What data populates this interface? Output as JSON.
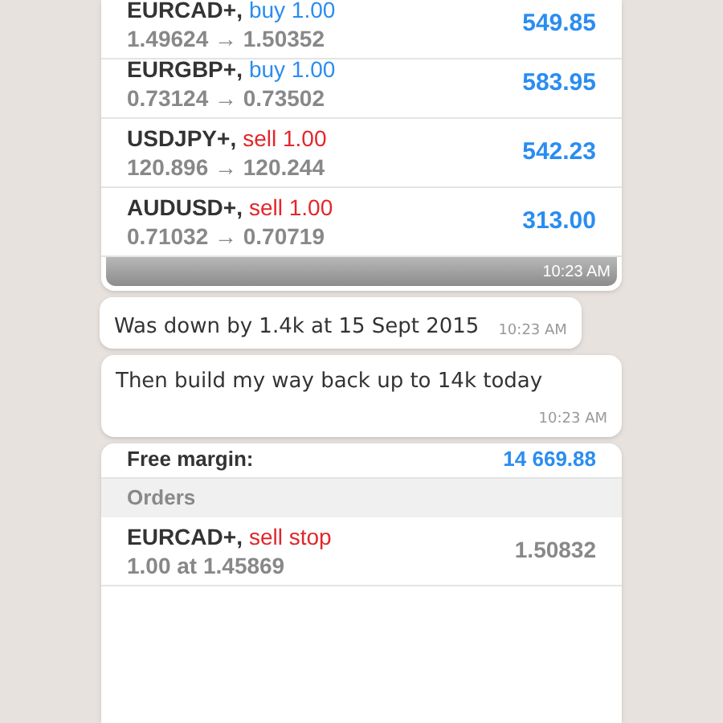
{
  "messages": [
    {
      "kind": "screenshot",
      "positions": [
        {
          "symbol": "EURCAD+,",
          "kind": "buy",
          "action": "buy 1.00",
          "prices": "1.49624 → 1.50352",
          "profit": "549.85"
        },
        {
          "symbol": "EURGBP+,",
          "kind": "buy",
          "action": "buy 1.00",
          "prices": "0.73124 → 0.73502",
          "profit": "583.95"
        },
        {
          "symbol": "USDJPY+,",
          "kind": "sell",
          "action": "sell 1.00",
          "prices": "120.896 → 120.244",
          "profit": "542.23"
        },
        {
          "symbol": "AUDUSD+,",
          "kind": "sell",
          "action": "sell 1.00",
          "prices": "0.71032 → 0.70719",
          "profit": "313.00"
        }
      ],
      "time": "10:23 AM"
    },
    {
      "kind": "text",
      "text": "Was down by 1.4k at 15 Sept 2015",
      "time": "10:23 AM"
    },
    {
      "kind": "text",
      "text": "Then build my way back up to 14k today",
      "time": "10:23 AM"
    }
  ],
  "account": {
    "free_margin_label": "Free margin:",
    "free_margin_value": "14 669.88",
    "orders_heading": "Orders",
    "orders": [
      {
        "symbol": "EURCAD+,",
        "kind": "sell",
        "action": "sell stop",
        "detail": "1.00 at 1.45869",
        "price": "1.50832"
      }
    ]
  }
}
